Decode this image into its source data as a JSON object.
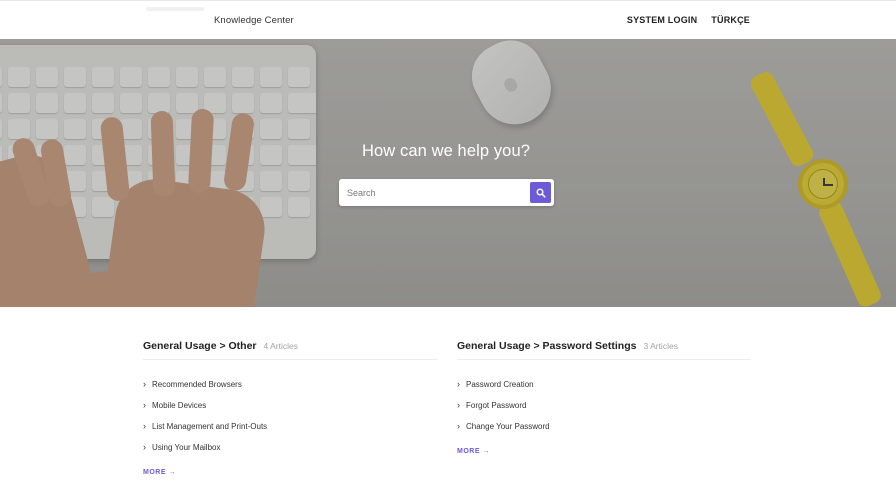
{
  "header": {
    "brand": "Knowledge Center",
    "nav": [
      {
        "label": "SYSTEM LOGIN"
      },
      {
        "label": "TÜRKÇE"
      }
    ]
  },
  "hero": {
    "title": "How can we help you?",
    "search": {
      "placeholder": "Search",
      "value": ""
    }
  },
  "categories": [
    {
      "title": "General Usage > Other",
      "count": "4 Articles",
      "items": [
        "Recommended Browsers",
        "Mobile Devices",
        "List Management and Print-Outs",
        "Using Your Mailbox"
      ],
      "more": "MORE →"
    },
    {
      "title": "General Usage > Password Settings",
      "count": "3 Articles",
      "items": [
        "Password Creation",
        "Forgot Password",
        "Change Your Password"
      ],
      "more": "MORE →"
    }
  ],
  "colors": {
    "accent": "#6c5bd6",
    "watch": "#e8cf2c"
  },
  "icons": [
    "search-icon",
    "chevron-right-icon",
    "arrow-right-icon"
  ]
}
